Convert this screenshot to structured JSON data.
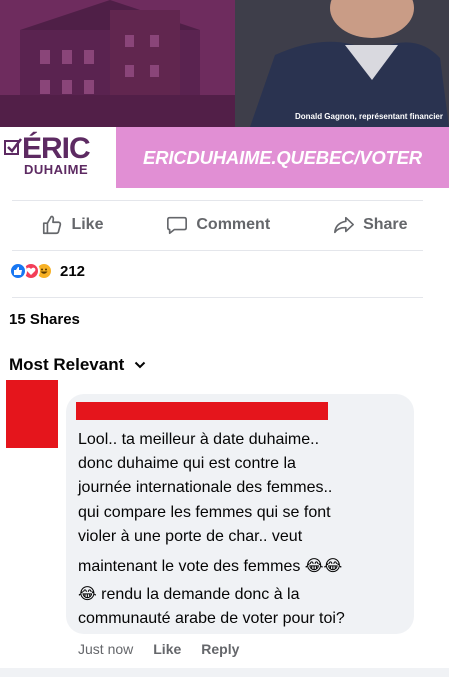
{
  "ad": {
    "photo_credit": "Donald Gagnon, représentant financier",
    "brand_name": "ÉRIC",
    "brand_surname": "DUHAIME",
    "url": "ERICDUHAIME.QUEBEC/VOTER",
    "colors": {
      "photo": "#6a2a5a",
      "brand": "#5d2a62",
      "url_bg": "#e18fd4"
    }
  },
  "actions": {
    "like": "Like",
    "comment": "Comment",
    "share": "Share"
  },
  "reactions": {
    "icons": [
      "like-icon",
      "love-icon",
      "haha-icon"
    ],
    "count": "212"
  },
  "shares": "15 Shares",
  "sort": {
    "label": "Most Relevant"
  },
  "comment": {
    "lines": [
      "Lool.. ta meilleur à date duhaime..",
      "donc duhaime qui est contre la",
      "journée internationale des femmes..",
      "qui compare les femmes qui se font",
      "violer à une porte de char.. veut",
      "maintenant le vote des femmes 😂😂",
      "😂 rendu la demande donc à la",
      "communauté arabe de voter pour toi?"
    ],
    "time": "Just now",
    "like": "Like",
    "reply": "Reply"
  }
}
